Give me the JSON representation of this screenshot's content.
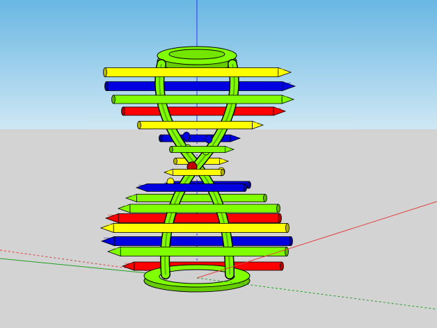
{
  "viewport": {
    "sky_top_color": "#69b7e3",
    "sky_bottom_color": "#cfe7f4",
    "ground_color": "#d3d3d3"
  },
  "model": {
    "frame_color": "#80ff00",
    "pencil_colors": [
      "#ffff00",
      "#0000e0",
      "#80ff00",
      "#ff0000"
    ],
    "bead_color": "#c00000"
  },
  "axes": {
    "red_color": "#e04040",
    "green_color": "#20a020",
    "blue_color": "#3030ff"
  }
}
